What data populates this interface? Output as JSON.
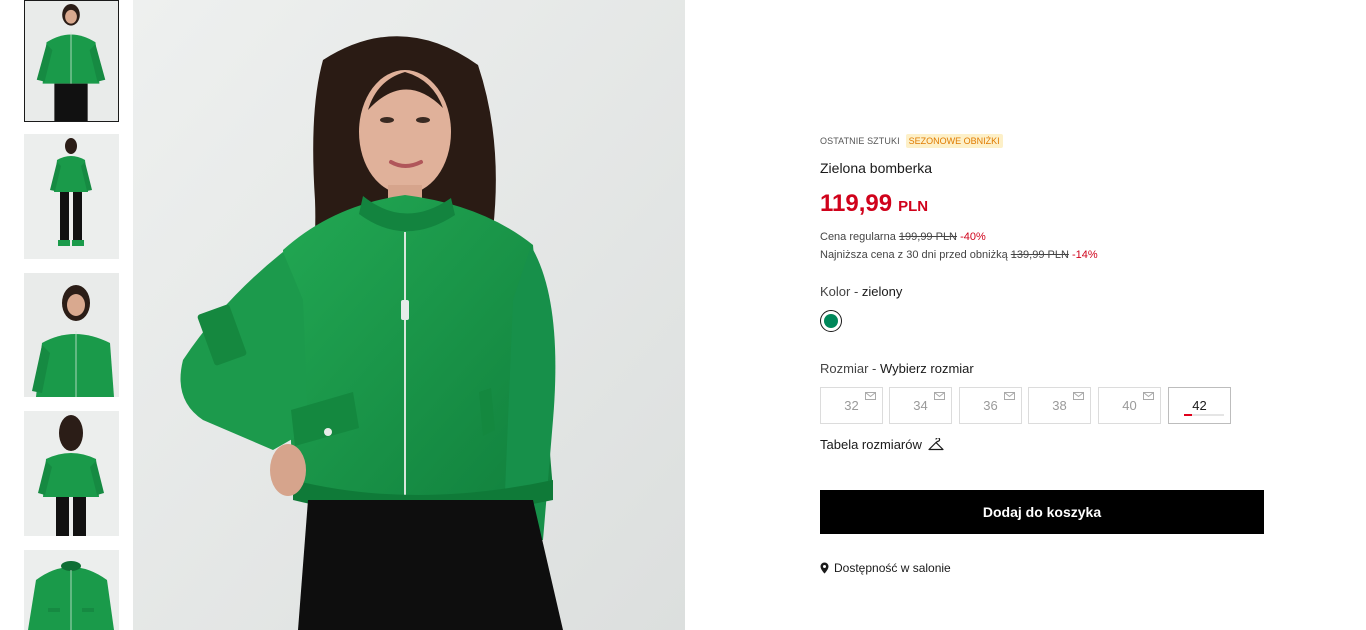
{
  "thumbnails": [
    {
      "alt": "thumbnail-1",
      "active": true
    },
    {
      "alt": "thumbnail-2",
      "active": false
    },
    {
      "alt": "thumbnail-3",
      "active": false
    },
    {
      "alt": "thumbnail-4",
      "active": false
    },
    {
      "alt": "thumbnail-5",
      "active": false
    }
  ],
  "product": {
    "badge_stock": "OSTATNIE SZTUKI",
    "badge_sale": "SEZONOWE OBNIŻKI",
    "title": "Zielona bomberka",
    "price_value": "119,99",
    "price_currency": "PLN",
    "regular_label": "Cena regularna",
    "regular_price": "199,99 PLN",
    "regular_discount": "-40%",
    "lowest_label": "Najniższa cena z 30 dni przed obniżką",
    "lowest_price": "139,99 PLN",
    "lowest_discount": "-14%"
  },
  "color": {
    "label": "Kolor - ",
    "value": "zielony",
    "swatch": "#00875a"
  },
  "size": {
    "label": "Rozmiar - ",
    "value": "Wybierz rozmiar",
    "options": [
      {
        "label": "32",
        "available": false
      },
      {
        "label": "34",
        "available": false
      },
      {
        "label": "36",
        "available": false
      },
      {
        "label": "38",
        "available": false
      },
      {
        "label": "40",
        "available": false
      },
      {
        "label": "42",
        "available": true,
        "stock_level": 0.2
      }
    ]
  },
  "size_chart": {
    "label": "Tabela rozmiarów",
    "icon": "hanger-icon"
  },
  "add_to_cart": {
    "label": "Dodaj do koszyka"
  },
  "store_availability": {
    "label": "Dostępność w salonie",
    "icon": "location-pin-icon"
  },
  "colors": {
    "accent_red": "#d0021b",
    "jacket_green": "#1a9a4a",
    "button_black": "#000000"
  }
}
